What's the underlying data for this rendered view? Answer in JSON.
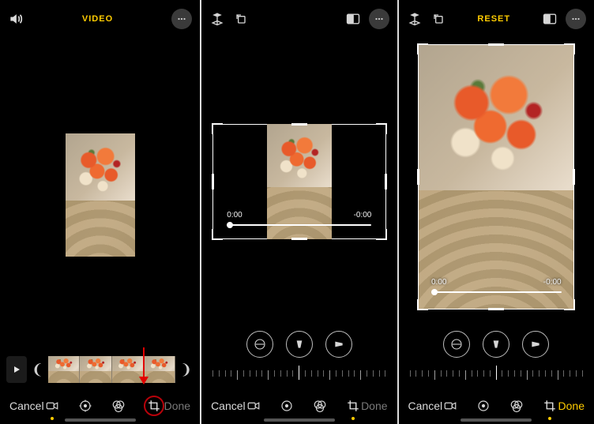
{
  "screens": [
    {
      "topbar": {
        "center_label": "VIDEO",
        "center_color": "#ffcc00"
      },
      "timeline": {
        "visible": true
      },
      "bottom": {
        "cancel": "Cancel",
        "done": "Done",
        "done_enabled": false,
        "active_mode": 0
      }
    },
    {
      "topbar": {
        "center_label": "",
        "center_color": "#ffcc00"
      },
      "crop": {
        "time_start": "0:00",
        "time_end": "-0:00",
        "orientation": "landscape"
      },
      "bottom": {
        "cancel": "Cancel",
        "done": "Done",
        "done_enabled": false,
        "active_mode": 3
      }
    },
    {
      "topbar": {
        "center_label": "RESET",
        "center_color": "#ffcc00"
      },
      "crop": {
        "time_start": "0:00",
        "time_end": "-0:00",
        "orientation": "portrait"
      },
      "bottom": {
        "cancel": "Cancel",
        "done": "Done",
        "done_enabled": true,
        "active_mode": 3
      }
    }
  ],
  "labels": {
    "cancel": "Cancel",
    "done": "Done"
  },
  "icons": {
    "volume": "volume-icon",
    "more": "more-icon",
    "flip_v": "flip-vertical-icon",
    "rotate": "rotate-icon",
    "aspect": "aspect-ratio-icon",
    "play": "play-icon",
    "straighten": "straighten-icon",
    "vertical": "vertical-perspective-icon",
    "horizontal": "horizontal-perspective-icon",
    "video_mode": "video-mode-icon",
    "adjust_mode": "adjust-mode-icon",
    "filters_mode": "filters-mode-icon",
    "crop_mode": "crop-mode-icon"
  }
}
